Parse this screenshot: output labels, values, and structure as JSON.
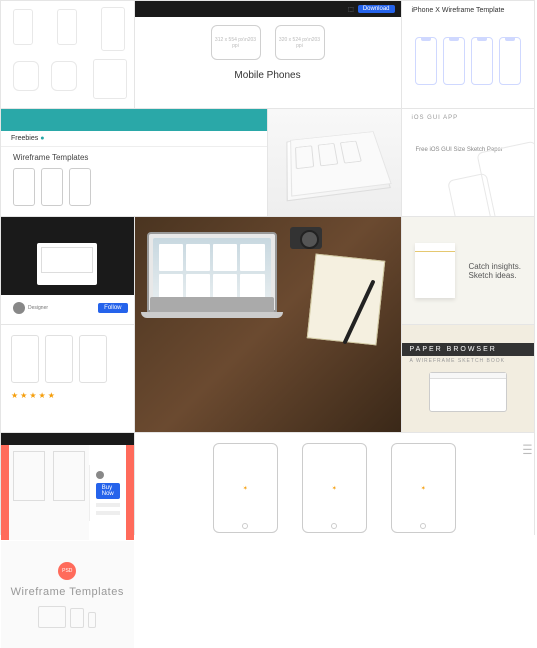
{
  "row1": {
    "mobile_phones": {
      "title": "Mobile Phones",
      "box1": "312 x 554 px\\n203 ppi",
      "box2": "320 x 524 px\\n203 ppi",
      "button": "Download"
    },
    "iphonex": {
      "title": "iPhone X Wireframe Template"
    }
  },
  "row2": {
    "freebies": {
      "brand": "Freebies",
      "heading": "Wireframe Templates"
    },
    "gui": {
      "brand": "iOS GUI APP",
      "caption": "Free iOS GUI Size Sketch Paper"
    }
  },
  "row3": {
    "profile": {
      "name": "Designer",
      "button": "Follow"
    },
    "insights": {
      "line1": "Catch insights.",
      "line2": "Sketch ideas."
    },
    "browser": {
      "title": "PAPER BROWSER",
      "sub": "A WIREFRAME SKETCH BOOK"
    }
  },
  "row4": {
    "red": {
      "button": "Buy Now"
    },
    "wt": {
      "badge": "PSD",
      "title": "Wireframe Templates"
    }
  },
  "ipads": {
    "label": " "
  }
}
